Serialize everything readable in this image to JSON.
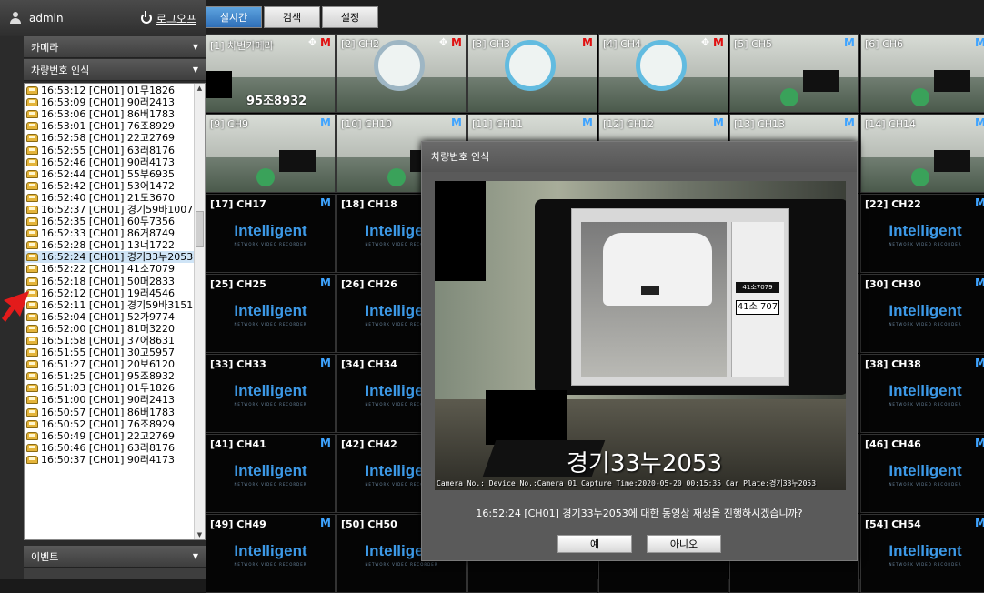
{
  "header": {
    "username": "admin",
    "logout_label": "로그오프"
  },
  "sidebar": {
    "camera_section": "카메라",
    "plate_section": "차량번호 인식",
    "event_section": "이벤트",
    "plate_entries": [
      "16:53:12 [CH01] 01무1826",
      "16:53:09 [CH01] 90러2413",
      "16:53:06 [CH01] 86버1783",
      "16:53:01 [CH01] 76조8929",
      "16:52:58 [CH01] 22고2769",
      "16:52:55 [CH01] 63러8176",
      "16:52:46 [CH01] 90러4173",
      "16:52:44 [CH01] 55부6935",
      "16:52:42 [CH01] 53어1472",
      "16:52:40 [CH01] 21도3670",
      "16:52:37 [CH01] 경기59바1007",
      "16:52:35 [CH01] 60두7356",
      "16:52:33 [CH01] 86거8749",
      "16:52:28 [CH01] 13너1722",
      "16:52:24 [CH01] 경기33누2053",
      "16:52:22 [CH01] 41소7079",
      "16:52:18 [CH01] 50머2833",
      "16:52:12 [CH01] 19러4546",
      "16:52:11 [CH01] 경기59바3151",
      "16:52:04 [CH01] 52가9774",
      "16:52:00 [CH01] 81머3220",
      "16:51:58 [CH01] 37어8631",
      "16:51:55 [CH01] 30고5957",
      "16:51:27 [CH01] 20보6120",
      "16:51:25 [CH01] 95조8932",
      "16:51:03 [CH01] 01두1826",
      "16:51:00 [CH01] 90러2413",
      "16:50:57 [CH01] 86버1783",
      "16:50:52 [CH01] 76조8929",
      "16:50:49 [CH01] 22고2769",
      "16:50:46 [CH01] 63러8176",
      "16:50:37 [CH01] 90러4173"
    ],
    "selected_index": 14
  },
  "tabs": [
    "실시간",
    "검색",
    "설정"
  ],
  "active_tab": 0,
  "cameras": [
    {
      "label": "[1] 차번카메라",
      "badge": "M",
      "badge_color": "red",
      "move": true,
      "plate": "95조8932",
      "live": true
    },
    {
      "label": "[2] CH2",
      "badge": "M",
      "badge_color": "red",
      "move": true,
      "live": true
    },
    {
      "label": "[3] CH3",
      "badge": "M",
      "badge_color": "red",
      "live": true,
      "clock": "blue"
    },
    {
      "label": "[4] CH4",
      "badge": "M",
      "badge_color": "red",
      "move": true,
      "live": true,
      "clock": "blue"
    },
    {
      "label": "[5] CH5",
      "badge": "M",
      "badge_color": "blue",
      "live": true
    },
    {
      "label": "[6] CH6",
      "badge": "M",
      "badge_color": "blue",
      "live": true
    },
    {
      "label": "[9] CH9",
      "badge": "M",
      "badge_color": "blue",
      "live": true
    },
    {
      "label": "[10] CH10",
      "badge": "M",
      "badge_color": "blue",
      "live": true
    },
    {
      "label": "[11] CH11",
      "badge": "M",
      "badge_color": "blue",
      "live": true
    },
    {
      "label": "[12] CH12",
      "badge": "M",
      "badge_color": "blue",
      "live": true
    },
    {
      "label": "[13] CH13",
      "badge": "M",
      "badge_color": "blue",
      "live": true
    },
    {
      "label": "[14] CH14",
      "badge": "M",
      "badge_color": "blue",
      "live": true
    },
    {
      "label": "[17] CH17",
      "badge": "M",
      "badge_color": "blue"
    },
    {
      "label": "[18] CH18",
      "badge": "",
      "badge_color": "blue"
    },
    {
      "label": "",
      "badge": ""
    },
    {
      "label": "",
      "badge": ""
    },
    {
      "label": "",
      "badge": ""
    },
    {
      "label": "[22] CH22",
      "badge": "M",
      "badge_color": "blue"
    },
    {
      "label": "[25] CH25",
      "badge": "M",
      "badge_color": "blue"
    },
    {
      "label": "[26] CH26",
      "badge": "",
      "badge_color": "blue"
    },
    {
      "label": "",
      "badge": ""
    },
    {
      "label": "",
      "badge": ""
    },
    {
      "label": "",
      "badge": ""
    },
    {
      "label": "[30] CH30",
      "badge": "M",
      "badge_color": "blue"
    },
    {
      "label": "[33] CH33",
      "badge": "M",
      "badge_color": "blue"
    },
    {
      "label": "[34] CH34",
      "badge": "",
      "badge_color": "blue"
    },
    {
      "label": "",
      "badge": ""
    },
    {
      "label": "",
      "badge": ""
    },
    {
      "label": "",
      "badge": ""
    },
    {
      "label": "[38] CH38",
      "badge": "M",
      "badge_color": "blue"
    },
    {
      "label": "[41] CH41",
      "badge": "M",
      "badge_color": "blue"
    },
    {
      "label": "[42] CH42",
      "badge": "",
      "badge_color": "blue"
    },
    {
      "label": "",
      "badge": ""
    },
    {
      "label": "",
      "badge": ""
    },
    {
      "label": "",
      "badge": ""
    },
    {
      "label": "[46] CH46",
      "badge": "M",
      "badge_color": "blue"
    },
    {
      "label": "[49] CH49",
      "badge": "M",
      "badge_color": "blue"
    },
    {
      "label": "[50] CH50",
      "badge": "",
      "badge_color": "blue"
    },
    {
      "label": "",
      "badge": ""
    },
    {
      "label": "",
      "badge": ""
    },
    {
      "label": "",
      "badge": ""
    },
    {
      "label": "[54] CH54",
      "badge": "M",
      "badge_color": "blue"
    }
  ],
  "logo_text": "Intelligent",
  "logo_subtext": "NETWORK VIDEO RECORDER",
  "dialog": {
    "title": "차량번호 인식",
    "plate_overlay": "경기33누2053",
    "chip_text": "41소 707",
    "chip_small": "41소7079",
    "caption": "Camera No.: Device No.:Camera 01 Capture Time:2020-05-20 00:15:35  Car Plate:경기33누2053",
    "message": "16:52:24 [CH01] 경기33누2053에 대한 동영상 재생을 진행하시겠습니까?",
    "yes_label": "예",
    "no_label": "아니오"
  }
}
